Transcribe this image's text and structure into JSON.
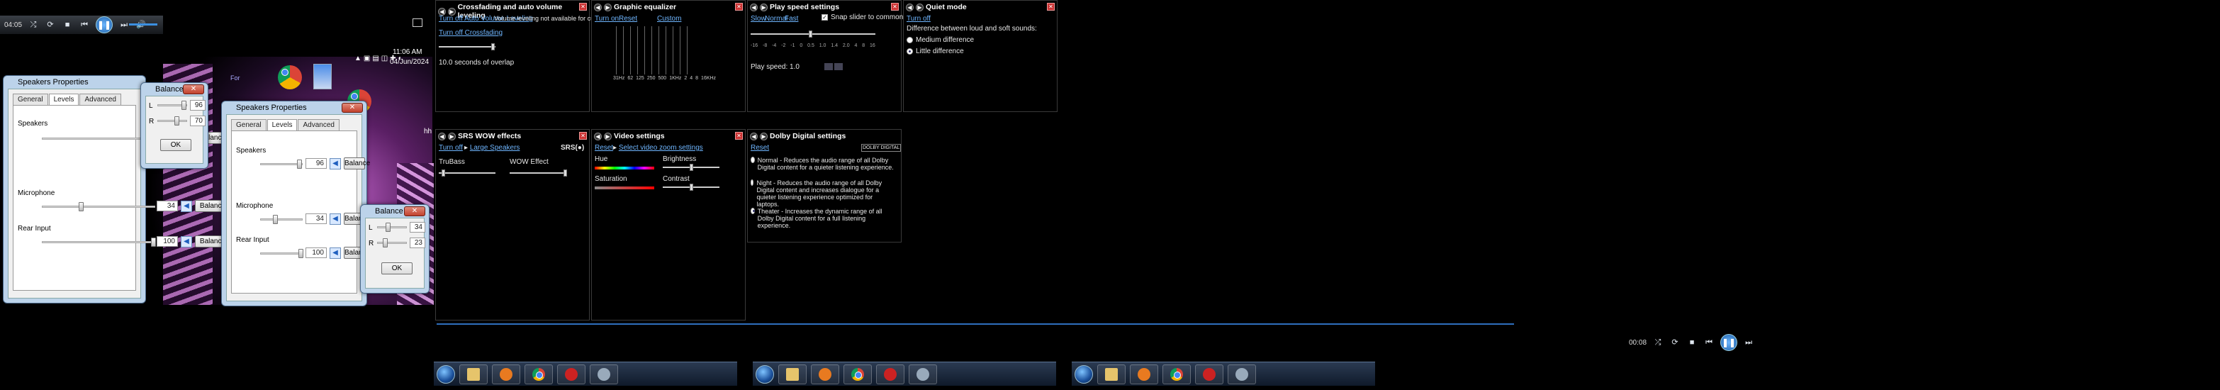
{
  "left": {
    "player": {
      "time": "04:05"
    },
    "clock": {
      "time": "11:06 AM",
      "date": "04/Jun/2024"
    },
    "speakers_props_a": {
      "title": "Speakers Properties",
      "tabs": [
        "General",
        "Levels",
        "Advanced"
      ],
      "active_tab": "Levels",
      "rows": [
        {
          "label": "Speakers",
          "value": "96",
          "level": 0.96
        },
        {
          "label": "Microphone",
          "value": "34",
          "level": 0.34
        },
        {
          "label": "Rear Input",
          "value": "100",
          "level": 1.0
        }
      ],
      "balance_label": "Balance"
    },
    "balance_a": {
      "title": "Balance",
      "l_label": "L",
      "r_label": "R",
      "l_value": "96",
      "r_value": "70",
      "l_level": 0.96,
      "r_level": 0.7,
      "ok": "OK"
    },
    "speakers_props_b": {
      "title": "Speakers Properties",
      "tabs": [
        "General",
        "Levels",
        "Advanced"
      ],
      "active_tab": "Levels",
      "rows": [
        {
          "label": "Speakers",
          "value": "96",
          "level": 0.96
        },
        {
          "label": "Microphone",
          "value": "34",
          "level": 0.34
        },
        {
          "label": "Rear Input",
          "value": "100",
          "level": 1.0
        }
      ],
      "balance_label": "Balance"
    },
    "balance_b": {
      "title": "Balance",
      "l_label": "L",
      "r_label": "R",
      "l_value": "34",
      "r_value": "23",
      "l_level": 0.34,
      "r_level": 0.23,
      "ok": "OK"
    },
    "desktop_fragments": {
      "a": "hh",
      "b": "rome",
      "c": "For"
    }
  },
  "right": {
    "crossfade": {
      "title": "Crossfading and auto volume leveling",
      "link1": "Turn off Auto Volume Leveling",
      "note1": "Volume leveling not available for current media",
      "link2": "Turn off Crossfading",
      "overlap": "10.0 seconds of overlap"
    },
    "equalizer": {
      "title": "Graphic equalizer",
      "turn_on": "Turn on",
      "reset": "Reset",
      "preset": "Custom",
      "bands": [
        "31Hz",
        "62",
        "125",
        "250",
        "500",
        "1KHz",
        "2",
        "4",
        "8",
        "16KHz"
      ]
    },
    "play_speed": {
      "title": "Play speed settings",
      "slow": "Slow",
      "normal": "Normal",
      "fast": "Fast",
      "snap": "Snap slider to common speeds",
      "ticks": [
        "-16",
        "-8",
        "-4",
        "-2",
        "-1",
        "0",
        "0.5",
        "1.0",
        "1.4",
        "2.0",
        "4",
        "8",
        "16"
      ],
      "speed_label": "Play speed: 1.0"
    },
    "quiet": {
      "title": "Quiet mode",
      "turn_off": "Turn off",
      "desc": "Difference between loud and soft sounds:",
      "opt1": "Medium difference",
      "opt2": "Little difference"
    },
    "srs": {
      "title": "SRS WOW effects",
      "turn_off": "Turn off",
      "speakers": "Large Speakers",
      "logo": "SRS(●)",
      "trubass": "TruBass",
      "wow": "WOW Effect"
    },
    "video": {
      "title": "Video settings",
      "reset": "Reset",
      "zoom": "Select video zoom settings",
      "hue": "Hue",
      "brightness": "Brightness",
      "saturation": "Saturation",
      "contrast": "Contrast"
    },
    "dolby": {
      "title": "Dolby Digital settings",
      "reset": "Reset",
      "logo": "DOLBY DIGITAL",
      "opt1": "Normal - Reduces the audio range of all Dolby Digital content for a quieter listening experience.",
      "opt2": "Night - Reduces the audio range of all Dolby Digital content and increases dialogue for a quieter listening experience optimized for laptops.",
      "opt3": "Theater - Increases the dynamic range of all Dolby Digital content for a full listening experience."
    },
    "player": {
      "time": "00:08"
    }
  }
}
